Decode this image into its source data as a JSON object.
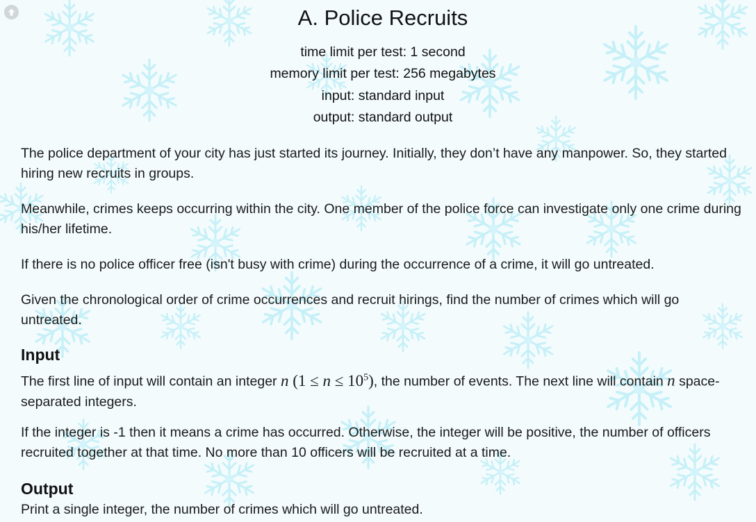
{
  "problem": {
    "title": "A. Police Recruits",
    "time_limit": "time limit per test: 1 second",
    "memory_limit": "memory limit per test: 256 megabytes",
    "input": "input: standard input",
    "output": "output: standard output"
  },
  "statement": {
    "p1": "The police department of your city has just started its journey. Initially, they don’t have any manpower. So, they started hiring new recruits in groups.",
    "p2": "Meanwhile, crimes keeps occurring within the city. One member of the police force can investigate only one crime during his/her lifetime.",
    "p3": "If there is no police officer free (isn't busy with crime) during the occurrence of a crime, it will go untreated.",
    "p4": "Given the chronological order of crime occurrences and recruit hirings, find the number of crimes which will go untreated."
  },
  "input_section": {
    "heading": "Input",
    "p1_before": "The first line of input will contain an integer ",
    "p1_var": "n",
    "p1_constraint_open": "(1 ≤ ",
    "p1_constraint_var": "n",
    "p1_constraint_mid": " ≤ 10",
    "p1_constraint_exp": "5",
    "p1_constraint_close": ")",
    "p1_after": ", the number of events. The next line will contain ",
    "p1_var2": "n",
    "p1_end": " space-separated integers.",
    "p2": "If the integer is -1 then it means a crime has occurred. Otherwise, the integer will be positive, the number of officers recruited together at that time. No more than 10 officers will be recruited at a time."
  },
  "output_section": {
    "heading": "Output",
    "p1": "Print a single integer, the number of crimes which will go untreated."
  },
  "icons": {
    "corner": "scroll-up-icon",
    "background": "snowflake-icon"
  },
  "colors": {
    "background": "#f3fbfd",
    "snowflake": "#bdeef6"
  }
}
